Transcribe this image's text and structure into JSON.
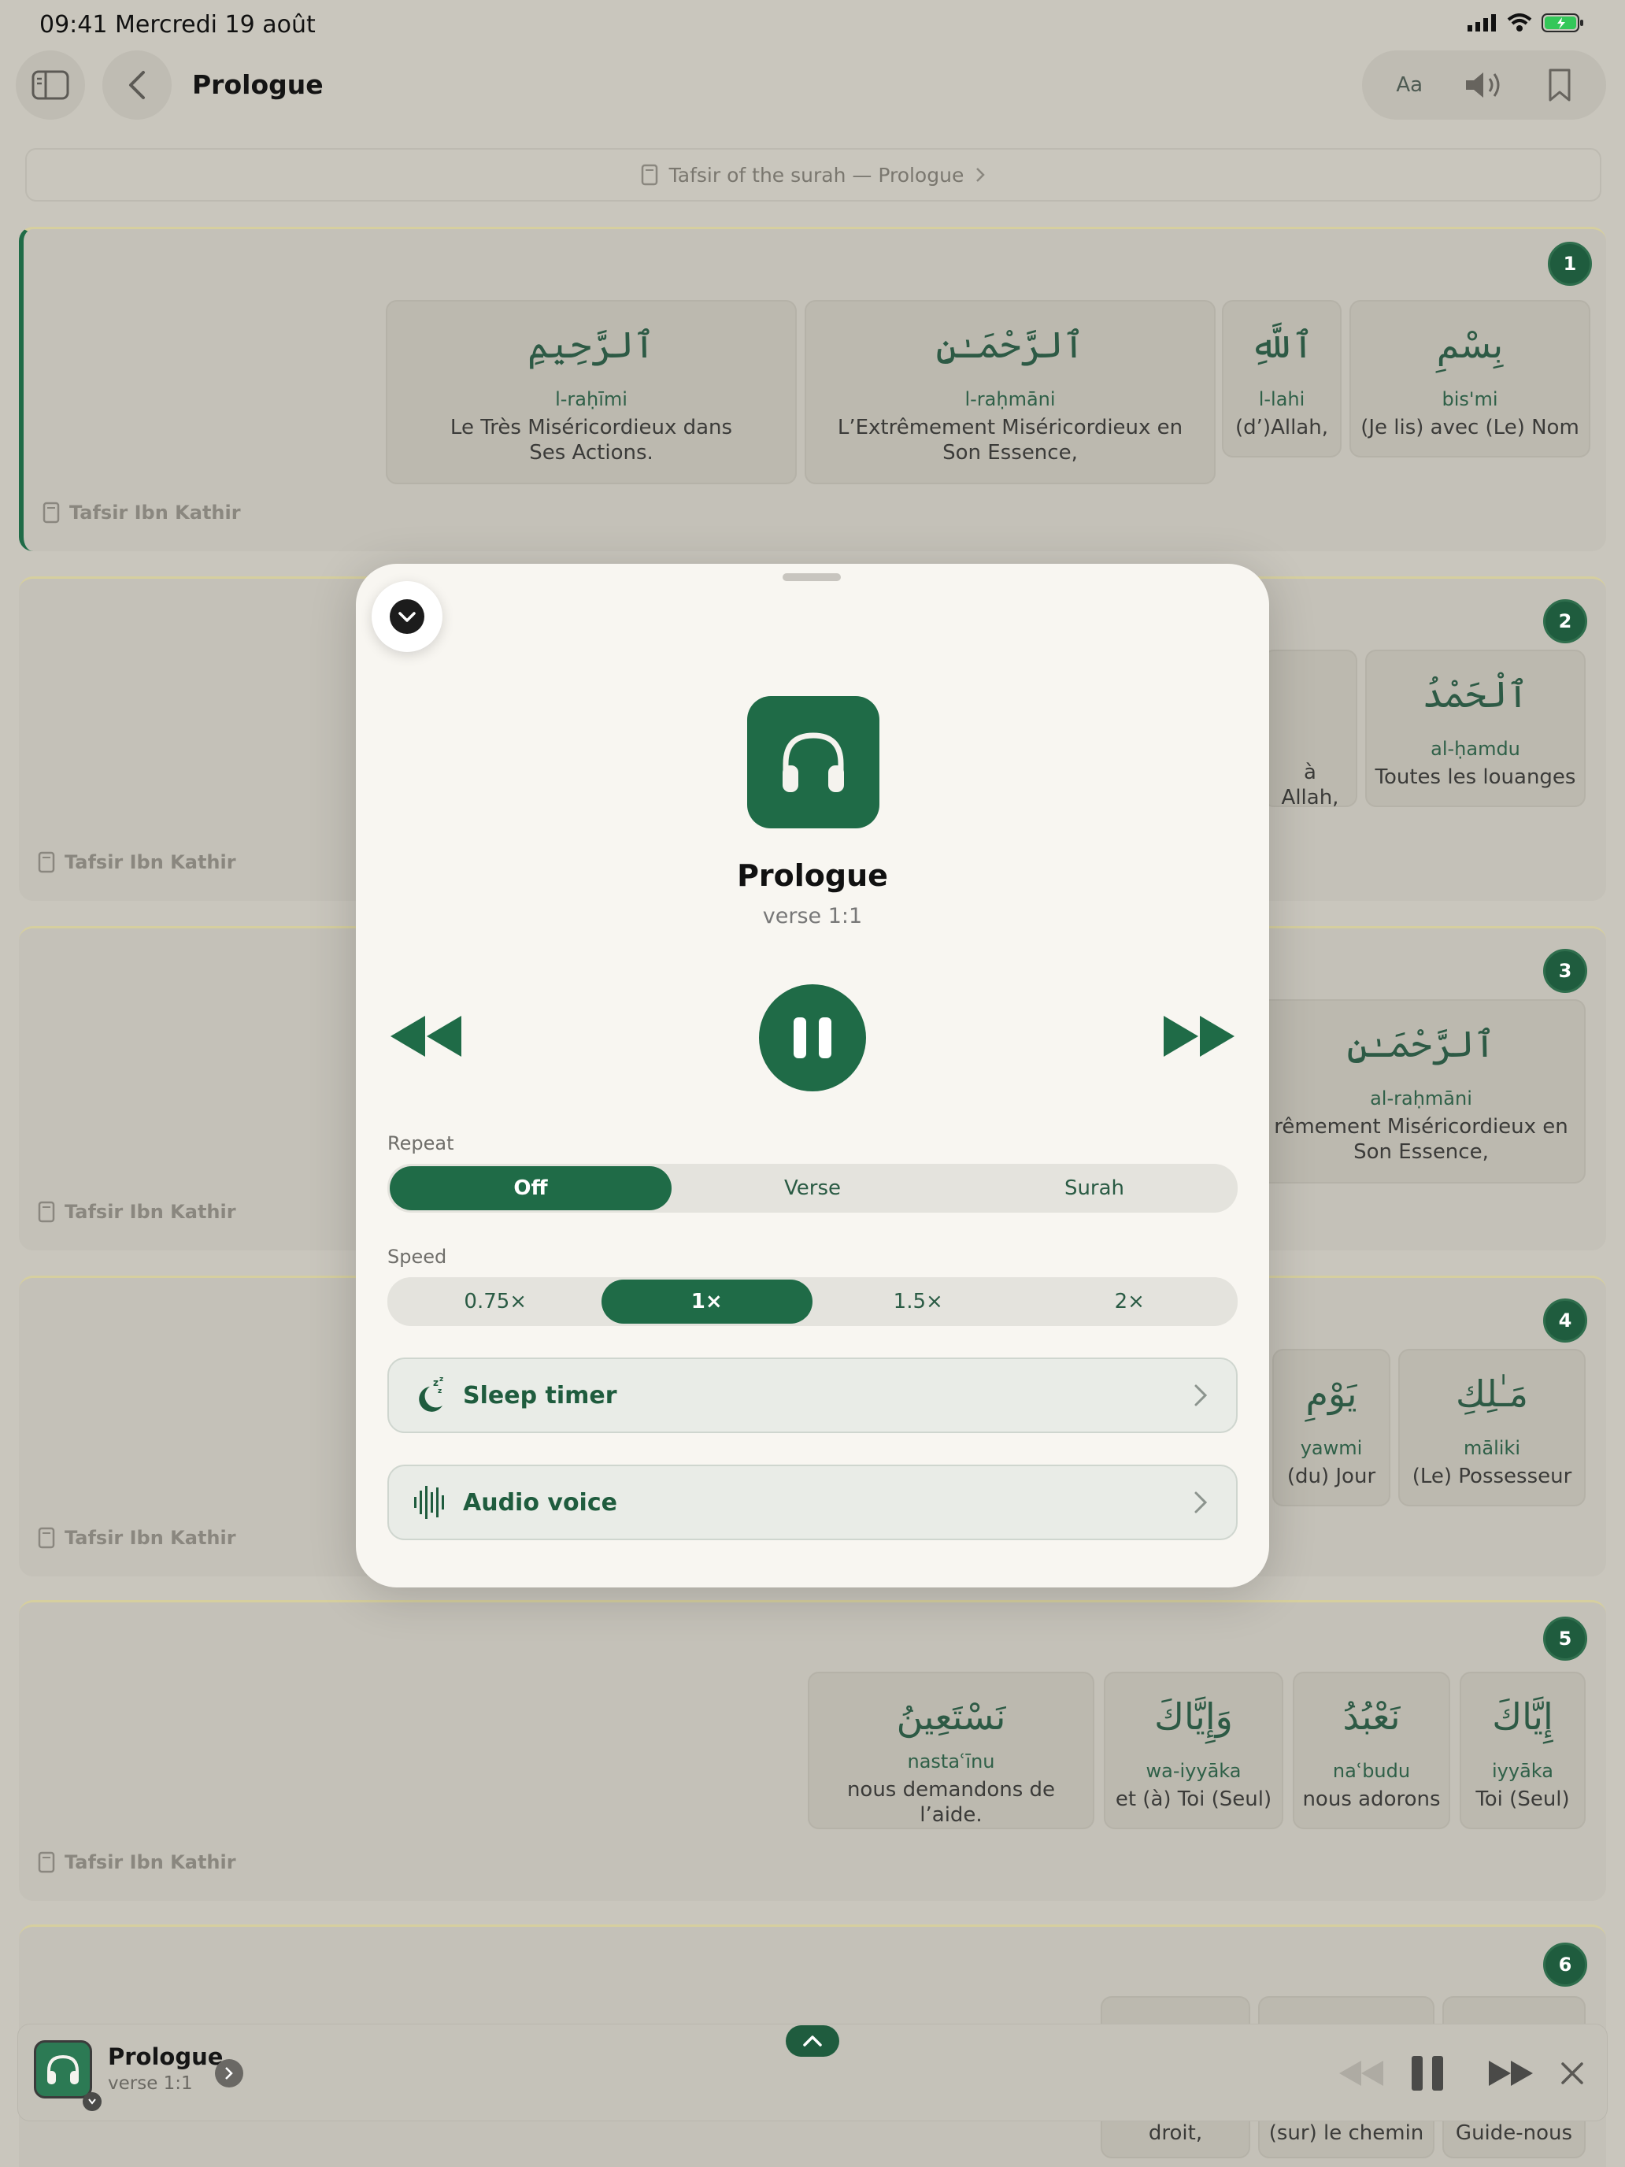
{
  "status": {
    "time": "09:41",
    "date": "Mercredi 19 août"
  },
  "header": {
    "title": "Prologue",
    "font_label": "Aa"
  },
  "breadcrumb": {
    "label": "Tafsir of the surah — Prologue"
  },
  "tafsir_label": "Tafsir Ibn Kathir",
  "verses": [
    {
      "number": "1",
      "words": [
        {
          "arabic": "ٱلرَّحِيمِ",
          "translit": "l-raḥīmi",
          "trans1": "Le Très Miséricordieux dans",
          "trans2": "Ses Actions."
        },
        {
          "arabic": "ٱلرَّحْمَـٰنِ",
          "translit": "l-raḥmāni",
          "trans1": "L’Extrêmement Miséricordieux en",
          "trans2": "Son Essence,"
        },
        {
          "arabic": "ٱللَّهِ",
          "translit": "l-lahi",
          "trans1": "(d’)Allah,",
          "trans2": ""
        },
        {
          "arabic": "بِسْمِ",
          "translit": "bis'mi",
          "trans1": "(Je lis) avec (Le) Nom",
          "trans2": ""
        }
      ]
    },
    {
      "number": "2",
      "words": [
        {
          "arabic": "",
          "translit": "",
          "trans1": "à Allah,",
          "trans2": ""
        },
        {
          "arabic": "ٱلْحَمْدُ",
          "translit": "al-ḥamdu",
          "trans1": "Toutes les louanges",
          "trans2": ""
        }
      ]
    },
    {
      "number": "3",
      "words": [
        {
          "arabic": "ٱلرَّحْمَـٰنِ",
          "translit": "al-raḥmāni",
          "trans1": "rêmement Miséricordieux en",
          "trans2": "Son Essence,"
        }
      ]
    },
    {
      "number": "4",
      "words": [
        {
          "arabic": "يَوْمِ",
          "translit": "yawmi",
          "trans1": "(du) Jour",
          "trans2": ""
        },
        {
          "arabic": "مَـٰلِكِ",
          "translit": "māliki",
          "trans1": "(Le) Possesseur",
          "trans2": ""
        }
      ]
    },
    {
      "number": "5",
      "words": [
        {
          "arabic": "نَسْتَعِينُ",
          "translit": "nastaʿīnu",
          "trans1": "nous demandons de l’aide.",
          "trans2": ""
        },
        {
          "arabic": "وَإِيَّاكَ",
          "translit": "wa-iyyāka",
          "trans1": "et (à) Toi (Seul)",
          "trans2": ""
        },
        {
          "arabic": "نَعْبُدُ",
          "translit": "naʿbudu",
          "trans1": "nous adorons",
          "trans2": ""
        },
        {
          "arabic": "إِيَّاكَ",
          "translit": "iyyāka",
          "trans1": "Toi (Seul)",
          "trans2": ""
        }
      ]
    },
    {
      "number": "6",
      "words": [
        {
          "arabic": "",
          "translit": "",
          "trans1": "droit,",
          "trans2": ""
        },
        {
          "arabic": "",
          "translit": "",
          "trans1": "(sur) le chemin",
          "trans2": ""
        },
        {
          "arabic": "",
          "translit": "",
          "trans1": "Guide-nous",
          "trans2": ""
        }
      ]
    }
  ],
  "player": {
    "title": "Prologue",
    "subtitle": "verse 1:1",
    "repeat_label": "Repeat",
    "repeat_options": [
      "Off",
      "Verse",
      "Surah"
    ],
    "repeat_selected": "Off",
    "speed_label": "Speed",
    "speed_options": [
      "0.75×",
      "1×",
      "1.5×",
      "2×"
    ],
    "speed_selected": "1×",
    "sleep_timer": "Sleep timer",
    "audio_voice": "Audio voice"
  },
  "mini_player": {
    "title": "Prologue",
    "subtitle": "verse 1:1"
  },
  "colors": {
    "accent": "#1f6b47",
    "background": "#c9c6bd",
    "sheet": "#f8f6f1"
  }
}
